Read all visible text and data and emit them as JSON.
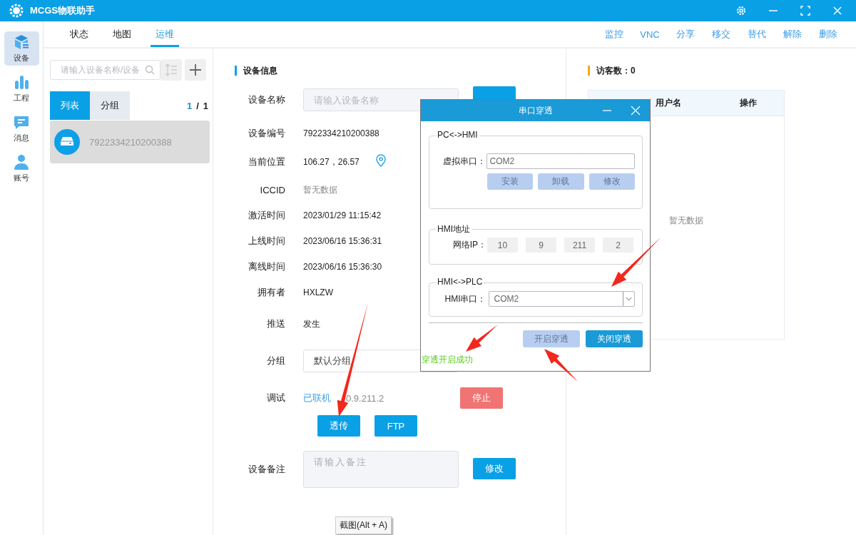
{
  "window": {
    "title": "MCGS物联助手"
  },
  "nav_rail": [
    {
      "label": "设备",
      "selected": true
    },
    {
      "label": "工程",
      "selected": false
    },
    {
      "label": "消息",
      "selected": false
    },
    {
      "label": "账号",
      "selected": false
    }
  ],
  "top_tabs": [
    {
      "label": "状态",
      "selected": false
    },
    {
      "label": "地图",
      "selected": false
    },
    {
      "label": "运维",
      "selected": true
    }
  ],
  "actions": [
    "监控",
    "VNC",
    "分享",
    "移交",
    "替代",
    "解除",
    "删除"
  ],
  "device_list": {
    "search": {
      "placeholder": "请输入设备名称/设备"
    },
    "segments": [
      {
        "label": "列表",
        "selected": true
      },
      {
        "label": "分组",
        "selected": false
      }
    ],
    "pager": {
      "current": "1",
      "separator": "/",
      "total": "1"
    },
    "devices": [
      {
        "id": "7922334210200388",
        "selected": true
      }
    ]
  },
  "device_info": {
    "title": "设备信息",
    "fields": [
      {
        "kind": "input",
        "label": "设备名称",
        "placeholder": "请输入设备名称"
      },
      {
        "kind": "text",
        "label": "设备编号",
        "value": "7922334210200388"
      },
      {
        "kind": "location",
        "label": "当前位置",
        "value": "106.27，26.57"
      },
      {
        "kind": "muted",
        "label": "ICCID",
        "value": "暂无数据"
      },
      {
        "kind": "text",
        "label": "激活时间",
        "value": "2023/01/29 11:15:42"
      },
      {
        "kind": "text",
        "label": "上线时间",
        "value": "2023/06/16 15:36:31"
      },
      {
        "kind": "text",
        "label": "离线时间",
        "value": "2023/06/16 15:36:30"
      },
      {
        "kind": "text",
        "label": "拥有者",
        "value": "HXLZW"
      },
      {
        "kind": "text",
        "label": "推送",
        "value": "发生"
      },
      {
        "kind": "select",
        "label": "分组",
        "value": "默认分组"
      },
      {
        "kind": "debug",
        "label": "调试",
        "link": "已联机",
        "value": "0.9.211.2",
        "button": "停止"
      },
      {
        "kind": "buttons",
        "buttons": [
          "透传",
          "FTP"
        ]
      },
      {
        "kind": "textarea",
        "label": "设备备注",
        "placeholder": "请输入备注",
        "button": "修改"
      }
    ]
  },
  "visitors": {
    "title": "访客数：0",
    "columns": [
      "用户名",
      "操作"
    ],
    "empty": "暂无数据"
  },
  "dialog": {
    "title": "串口穿透",
    "sections": [
      {
        "kind": "port",
        "legend": "PC<->HMI",
        "label": "虚拟串口：",
        "value": "COM2",
        "buttons": [
          {
            "label": "安装",
            "disabled": true
          },
          {
            "label": "卸载",
            "disabled": true
          },
          {
            "label": "修改",
            "disabled": true
          }
        ]
      },
      {
        "kind": "ip",
        "legend": "HMI地址",
        "label": "网络IP：",
        "octets": [
          "10",
          "9",
          "211",
          "2"
        ]
      },
      {
        "kind": "select",
        "legend": "HMI<->PLC",
        "label": "HMI串口：",
        "value": "COM2"
      }
    ],
    "buttons": [
      {
        "label": "开启穿透",
        "disabled": true
      },
      {
        "label": "关闭穿透",
        "disabled": false
      }
    ],
    "status": "穿透开启成功"
  },
  "tooltip": "截图(Alt + A)"
}
